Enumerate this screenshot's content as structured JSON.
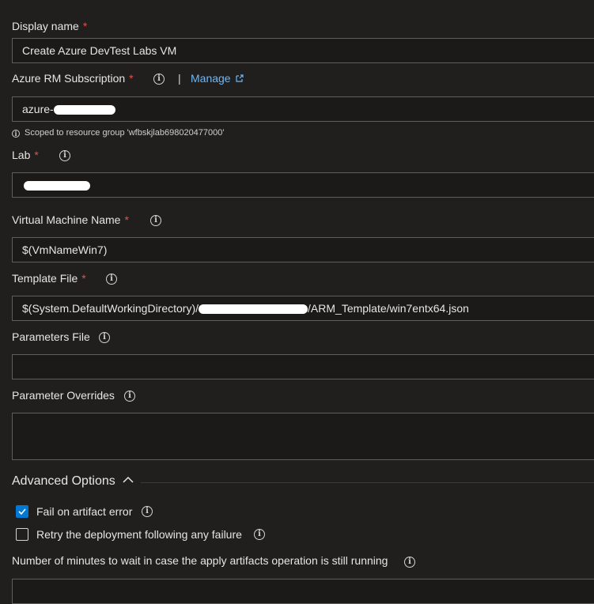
{
  "display_name": {
    "label": "Display name",
    "required": "*",
    "value": "Create Azure DevTest Labs VM"
  },
  "subscription": {
    "label": "Azure RM Subscription",
    "required": "*",
    "separator": "|",
    "manage_link": "Manage",
    "value_prefix": "azure-",
    "hint": "Scoped to resource group 'wfbskjlab698020477000'"
  },
  "lab": {
    "label": "Lab",
    "required": "*"
  },
  "vm_name": {
    "label": "Virtual Machine Name",
    "required": "*",
    "value": "$(VmNameWin7)"
  },
  "template_file": {
    "label": "Template File",
    "required": "*",
    "value_prefix": "$(System.DefaultWorkingDirectory)/",
    "value_suffix": "/ARM_Template/win7entx64.json"
  },
  "parameters_file": {
    "label": "Parameters File",
    "value": ""
  },
  "parameter_overrides": {
    "label": "Parameter Overrides",
    "value": ""
  },
  "advanced": {
    "title": "Advanced Options",
    "fail_on_artifact_error": {
      "label": "Fail on artifact error",
      "checked": true
    },
    "retry_deployment": {
      "label": "Retry the deployment following any failure",
      "checked": false
    },
    "wait_minutes_label": "Number of minutes to wait in case the apply artifacts operation is still running"
  },
  "icons": {
    "info": "info-icon",
    "external": "external-link-icon",
    "chevron": "chevron-up-icon",
    "check": "checkmark-icon"
  },
  "colors": {
    "background": "#201f1e",
    "accent": "#0078d4",
    "link": "#6cb8f6",
    "required": "#e0524f"
  }
}
